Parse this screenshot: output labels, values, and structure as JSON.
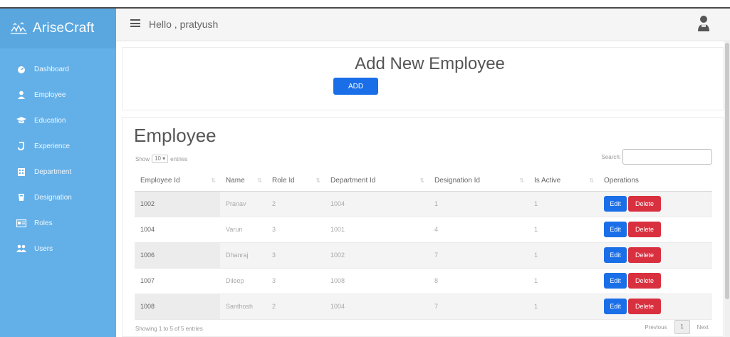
{
  "brand": {
    "name": "AriseCraft"
  },
  "sidebar": {
    "items": [
      {
        "label": "Dashboard",
        "icon": "dashboard-icon"
      },
      {
        "label": "Employee",
        "icon": "user-icon"
      },
      {
        "label": "Education",
        "icon": "graduation-cap-icon"
      },
      {
        "label": "Experience",
        "icon": "experience-icon"
      },
      {
        "label": "Department",
        "icon": "building-icon"
      },
      {
        "label": "Designation",
        "icon": "designation-icon"
      },
      {
        "label": "Roles",
        "icon": "id-card-icon"
      },
      {
        "label": "Users",
        "icon": "users-icon"
      }
    ]
  },
  "header": {
    "greeting": "Hello , pratyush"
  },
  "add_section": {
    "title": "Add New Employee",
    "button": "ADD"
  },
  "table_section": {
    "title": "Employee",
    "show_prefix": "Show",
    "show_value": "10",
    "show_suffix": "entries",
    "search_label": "Search:",
    "columns": [
      "Employee Id",
      "Name",
      "Role Id",
      "Department Id",
      "Designation Id",
      "Is Active",
      "Operations"
    ],
    "rows": [
      {
        "id": "1002",
        "name": "Pranav",
        "role": "2",
        "dept": "1004",
        "desig": "1",
        "active": "1"
      },
      {
        "id": "1004",
        "name": "Varun",
        "role": "3",
        "dept": "1001",
        "desig": "4",
        "active": "1"
      },
      {
        "id": "1006",
        "name": "Dhanraj",
        "role": "3",
        "dept": "1002",
        "desig": "7",
        "active": "1"
      },
      {
        "id": "1007",
        "name": "Dileep",
        "role": "3",
        "dept": "1008",
        "desig": "8",
        "active": "1"
      },
      {
        "id": "1008",
        "name": "Santhosh",
        "role": "2",
        "dept": "1004",
        "desig": "7",
        "active": "1"
      }
    ],
    "edit_label": "Edit",
    "delete_label": "Delete",
    "info": "Showing 1 to 5 of 5 entries",
    "prev": "Previous",
    "page": "1",
    "next": "Next"
  },
  "colors": {
    "sidebar": "#63b0e8",
    "primary": "#1a6fe8",
    "danger": "#d9303f"
  }
}
